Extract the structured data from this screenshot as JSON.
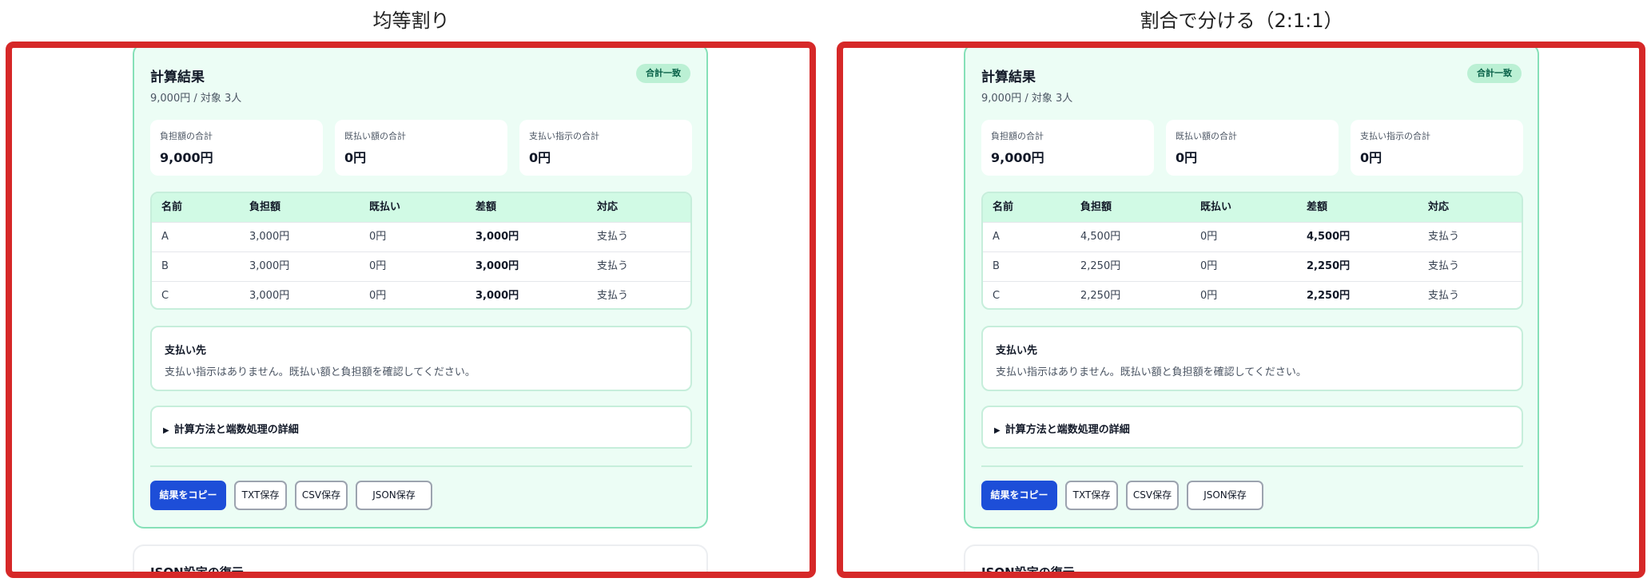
{
  "panels": [
    {
      "title": "均等割り",
      "result_title": "計算結果",
      "subtitle": "9,000円 / 対象 3人",
      "badge": "合計一致",
      "stats": [
        {
          "label": "負担額の合計",
          "value": "9,000円"
        },
        {
          "label": "既払い額の合計",
          "value": "0円"
        },
        {
          "label": "支払い指示の合計",
          "value": "0円"
        }
      ],
      "table": {
        "headers": [
          "名前",
          "負担額",
          "既払い",
          "差額",
          "対応"
        ],
        "rows": [
          [
            "A",
            "3,000円",
            "0円",
            "3,000円",
            "支払う"
          ],
          [
            "B",
            "3,000円",
            "0円",
            "3,000円",
            "支払う"
          ],
          [
            "C",
            "3,000円",
            "0円",
            "3,000円",
            "支払う"
          ]
        ]
      },
      "payment": {
        "title": "支払い先",
        "text": "支払い指示はありません。既払い額と負担額を確認してください。"
      },
      "details_label": "計算方法と端数処理の詳細",
      "buttons": [
        "結果をコピー",
        "TXT保存",
        "CSV保存",
        "JSON保存"
      ],
      "next_section_title": "JSON設定の復元"
    },
    {
      "title": "割合で分ける（2:1:1）",
      "result_title": "計算結果",
      "subtitle": "9,000円 / 対象 3人",
      "badge": "合計一致",
      "stats": [
        {
          "label": "負担額の合計",
          "value": "9,000円"
        },
        {
          "label": "既払い額の合計",
          "value": "0円"
        },
        {
          "label": "支払い指示の合計",
          "value": "0円"
        }
      ],
      "table": {
        "headers": [
          "名前",
          "負担額",
          "既払い",
          "差額",
          "対応"
        ],
        "rows": [
          [
            "A",
            "4,500円",
            "0円",
            "4,500円",
            "支払う"
          ],
          [
            "B",
            "2,250円",
            "0円",
            "2,250円",
            "支払う"
          ],
          [
            "C",
            "2,250円",
            "0円",
            "2,250円",
            "支払う"
          ]
        ]
      },
      "payment": {
        "title": "支払い先",
        "text": "支払い指示はありません。既払い額と負担額を確認してください。"
      },
      "details_label": "計算方法と端数処理の詳細",
      "buttons": [
        "結果をコピー",
        "TXT保存",
        "CSV保存",
        "JSON保存"
      ],
      "next_section_title": "JSON設定の復元"
    }
  ],
  "colors": {
    "highlight_border": "#d62828",
    "card_bg": "#ecfdf5",
    "card_border": "#86e0b8",
    "primary_button": "#1d4ed8",
    "badge_bg": "#bbf0d4"
  }
}
